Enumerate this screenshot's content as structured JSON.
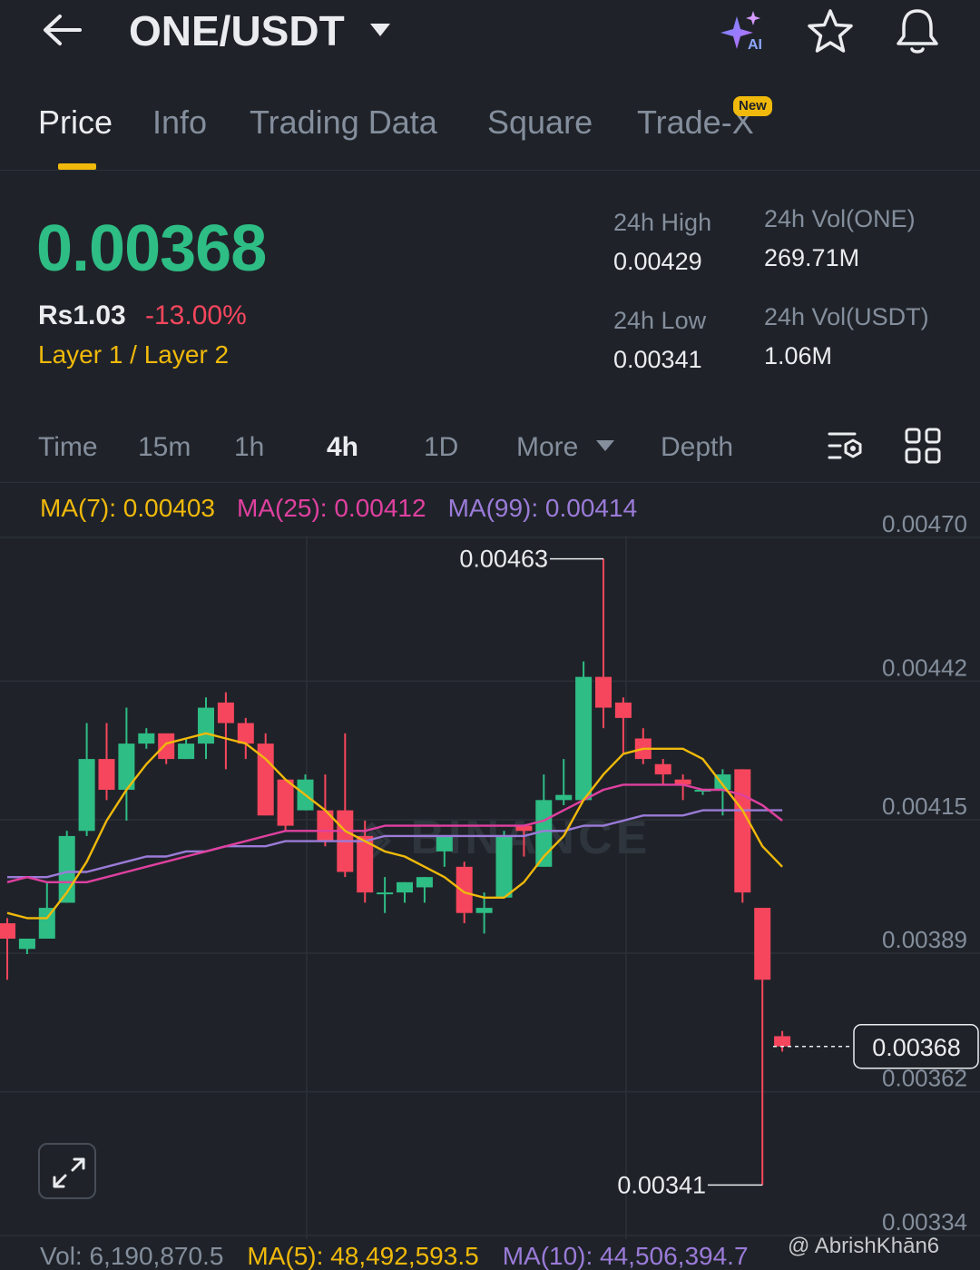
{
  "header": {
    "pair": "ONE/USDT",
    "icons": [
      "back-arrow-icon",
      "caret-down-icon",
      "ai-sparkle-icon",
      "star-icon",
      "bell-icon"
    ]
  },
  "tabs": [
    {
      "label": "Price",
      "active": true
    },
    {
      "label": "Info"
    },
    {
      "label": "Trading Data"
    },
    {
      "label": "Square"
    },
    {
      "label": "Trade-X",
      "badge": "New"
    }
  ],
  "ticker": {
    "last_price": "0.00368",
    "fiat_price": "Rs1.03",
    "change_pct": "-13.00%",
    "sector": "Layer 1 / Layer 2",
    "high_label": "24h High",
    "high_value": "0.00429",
    "low_label": "24h Low",
    "low_value": "0.00341",
    "vol_base_label": "24h Vol(ONE)",
    "vol_base_value": "269.71M",
    "vol_quote_label": "24h Vol(USDT)",
    "vol_quote_value": "1.06M"
  },
  "intervals": {
    "items": [
      "Time",
      "15m",
      "1h",
      "4h",
      "1D",
      "More",
      "Depth"
    ],
    "active": "4h"
  },
  "indicators": {
    "ma7": "MA(7): 0.00403",
    "ma25": "MA(25): 0.00412",
    "ma99": "MA(99): 0.00414"
  },
  "volume": {
    "vol": "Vol: 6,190,870.5",
    "ma5": "MA(5): 48,492,593.5",
    "ma10": "MA(10): 44,506,394.7"
  },
  "watermark": "@ AbrishKhān6",
  "colors": {
    "background": "#1f2329",
    "up": "#2ebd85",
    "down": "#f6465d",
    "accent": "#f0b90b",
    "ma7": "#f0b90b",
    "ma25": "#e040a0",
    "ma99": "#9b7bd8"
  },
  "chart_data": {
    "type": "candlestick",
    "interval": "4h",
    "y_axis_labels": [
      "0.00470",
      "0.00442",
      "0.00415",
      "0.00389",
      "0.00362",
      "0.00334"
    ],
    "ylim": [
      0.00334,
      0.0047
    ],
    "max_marker": "0.00463",
    "min_marker": "0.00341",
    "current_price_label": "0.00368",
    "grid": true,
    "candles": [
      [
        0.00392,
        0.00389,
        0.00381,
        0.00393
      ],
      [
        0.00387,
        0.00389,
        0.00386,
        0.00389
      ],
      [
        0.00389,
        0.00395,
        0.00389,
        0.004
      ],
      [
        0.00396,
        0.00409,
        0.00396,
        0.0041
      ],
      [
        0.0041,
        0.00424,
        0.00409,
        0.00431
      ],
      [
        0.00424,
        0.00418,
        0.00416,
        0.00431
      ],
      [
        0.00418,
        0.00427,
        0.00412,
        0.00434
      ],
      [
        0.00427,
        0.00429,
        0.00426,
        0.0043
      ],
      [
        0.00429,
        0.00424,
        0.00423,
        0.00428
      ],
      [
        0.00424,
        0.00427,
        0.00424,
        0.00428
      ],
      [
        0.00427,
        0.00434,
        0.00424,
        0.00436
      ],
      [
        0.00435,
        0.00431,
        0.00422,
        0.00437
      ],
      [
        0.00431,
        0.00427,
        0.00424,
        0.00432
      ],
      [
        0.00427,
        0.00413,
        0.00413,
        0.00429
      ],
      [
        0.0042,
        0.00411,
        0.0041,
        0.0042
      ],
      [
        0.00414,
        0.0042,
        0.00414,
        0.00421
      ],
      [
        0.00414,
        0.00408,
        0.00407,
        0.00421
      ],
      [
        0.00414,
        0.00402,
        0.00401,
        0.00429
      ],
      [
        0.00409,
        0.00398,
        0.00396,
        0.00412
      ],
      [
        0.00398,
        0.00398,
        0.00394,
        0.00401
      ],
      [
        0.00398,
        0.004,
        0.00396,
        0.004
      ],
      [
        0.00399,
        0.00401,
        0.00396,
        0.00401
      ],
      [
        0.00406,
        0.00409,
        0.00403,
        0.00409
      ],
      [
        0.00403,
        0.00394,
        0.00392,
        0.00404
      ],
      [
        0.00394,
        0.00395,
        0.0039,
        0.00398
      ],
      [
        0.00397,
        0.00409,
        0.00397,
        0.0041
      ],
      [
        0.00411,
        0.0041,
        0.00405,
        0.00411
      ],
      [
        0.00403,
        0.00416,
        0.00403,
        0.00421
      ],
      [
        0.00416,
        0.00417,
        0.00415,
        0.00424
      ],
      [
        0.00416,
        0.0044,
        0.00416,
        0.00443
      ],
      [
        0.0044,
        0.00434,
        0.0043,
        0.00463
      ],
      [
        0.00435,
        0.00432,
        0.00425,
        0.00436
      ],
      [
        0.00428,
        0.00424,
        0.00423,
        0.0043
      ],
      [
        0.00423,
        0.00421,
        0.00419,
        0.00424
      ],
      [
        0.0042,
        0.00419,
        0.00416,
        0.00421
      ],
      [
        0.00418,
        0.00418,
        0.00417,
        0.00418
      ],
      [
        0.00418,
        0.00421,
        0.00413,
        0.00422
      ],
      [
        0.00422,
        0.00398,
        0.00396,
        0.00422
      ],
      [
        0.00395,
        0.00381,
        0.00341,
        0.00395
      ],
      [
        0.0037,
        0.00368,
        0.00367,
        0.00371
      ]
    ],
    "ma7": [
      0.00394,
      0.00393,
      0.00393,
      0.00398,
      0.00404,
      0.00412,
      0.00418,
      0.00423,
      0.00427,
      0.00428,
      0.00429,
      0.00428,
      0.00427,
      0.00424,
      0.0042,
      0.00417,
      0.00414,
      0.0041,
      0.00408,
      0.00406,
      0.00405,
      0.00403,
      0.00401,
      0.00398,
      0.00397,
      0.00397,
      0.004,
      0.00405,
      0.00409,
      0.00416,
      0.00421,
      0.00425,
      0.00426,
      0.00426,
      0.00426,
      0.00424,
      0.00419,
      0.00414,
      0.00407,
      0.00403
    ],
    "ma25": [
      0.004,
      0.00401,
      0.004,
      0.004,
      0.004,
      0.00401,
      0.00402,
      0.00403,
      0.00404,
      0.00405,
      0.00406,
      0.00407,
      0.00408,
      0.00409,
      0.0041,
      0.0041,
      0.0041,
      0.0041,
      0.0041,
      0.00411,
      0.00411,
      0.00411,
      0.00411,
      0.00411,
      0.00411,
      0.00411,
      0.00411,
      0.00412,
      0.00414,
      0.00416,
      0.00418,
      0.00419,
      0.00419,
      0.00419,
      0.00419,
      0.00418,
      0.00418,
      0.00417,
      0.00415,
      0.00412
    ],
    "ma99": [
      0.00401,
      0.00401,
      0.00401,
      0.00402,
      0.00402,
      0.00403,
      0.00404,
      0.00405,
      0.00405,
      0.00406,
      0.00406,
      0.00407,
      0.00407,
      0.00407,
      0.00408,
      0.00408,
      0.00408,
      0.00408,
      0.00408,
      0.00409,
      0.00409,
      0.00409,
      0.00409,
      0.00409,
      0.00409,
      0.00409,
      0.00409,
      0.0041,
      0.0041,
      0.00411,
      0.00411,
      0.00412,
      0.00413,
      0.00413,
      0.00413,
      0.00414,
      0.00414,
      0.00414,
      0.00414,
      0.00414
    ]
  }
}
